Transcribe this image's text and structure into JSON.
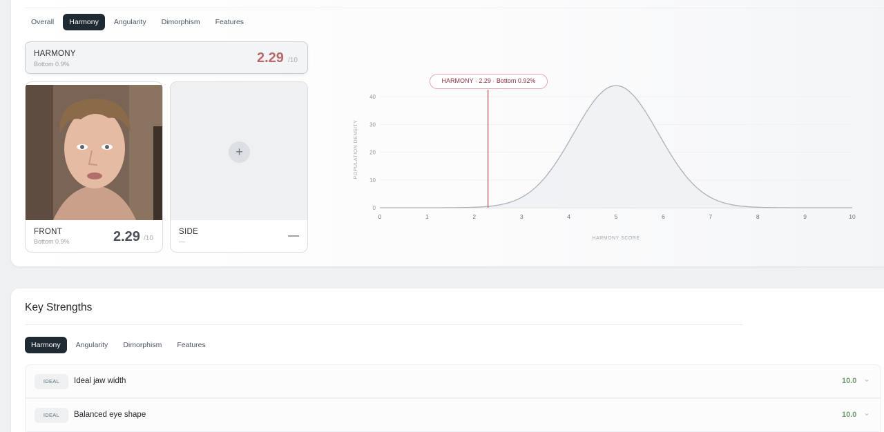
{
  "top_tabs": [
    {
      "label": "Overall",
      "active": false
    },
    {
      "label": "Harmony",
      "active": true
    },
    {
      "label": "Angularity",
      "active": false
    },
    {
      "label": "Dimorphism",
      "active": false
    },
    {
      "label": "Features",
      "active": false
    }
  ],
  "summary": {
    "title": "HARMONY",
    "sub": "Bottom 0.9%",
    "score": "2.29",
    "den": "/10"
  },
  "front_card": {
    "title": "FRONT",
    "sub": "Bottom 0.9%",
    "score": "2.29",
    "den": "/10"
  },
  "side_card": {
    "title": "SIDE",
    "sub": "—",
    "score": "—",
    "add_icon": "+"
  },
  "chart_tooltip": "HARMONY · 2.29 · Bottom 0.92%",
  "chart_data": {
    "type": "area",
    "xlabel": "HARMONY SCORE",
    "ylabel": "POPULATION DENSITY",
    "xlim": [
      0,
      10
    ],
    "ylim": [
      0,
      45
    ],
    "x_ticks": [
      0,
      1,
      2,
      3,
      4,
      5,
      6,
      7,
      8,
      9,
      10
    ],
    "y_ticks": [
      0,
      10,
      20,
      30,
      40
    ],
    "distribution": {
      "mean": 5,
      "sd": 0.9,
      "peak": 44
    },
    "marker": {
      "x": 2.29
    },
    "colors": {
      "curve": "#aab1b9",
      "fill": "#eef0f3",
      "marker": "#b0525e",
      "grid": "#eef0f2"
    }
  },
  "strengths": {
    "title": "Key Strengths",
    "tabs": [
      {
        "label": "Harmony",
        "active": true
      },
      {
        "label": "Angularity",
        "active": false
      },
      {
        "label": "Dimorphism",
        "active": false
      },
      {
        "label": "Features",
        "active": false
      }
    ],
    "rows": [
      {
        "badge": "IDEAL",
        "label": "Ideal jaw width",
        "score": "10.0"
      },
      {
        "badge": "IDEAL",
        "label": "Balanced eye shape",
        "score": "10.0"
      }
    ]
  },
  "colors": {
    "accent_dark": "#1f2a33",
    "bad_score": "#b86a6a",
    "front_score": "#4a5058",
    "good_score": "#6f9a6f"
  }
}
